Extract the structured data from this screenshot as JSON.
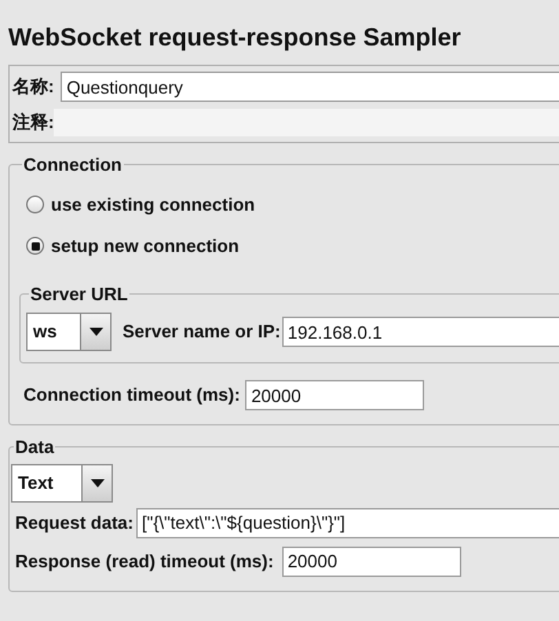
{
  "title": "WebSocket request-response Sampler",
  "name_field": {
    "label": "名称:",
    "value": "Questionquery"
  },
  "comment_field": {
    "label": "注释:"
  },
  "connection": {
    "legend": "Connection",
    "options": [
      {
        "label": "use existing connection",
        "selected": false
      },
      {
        "label": "setup new connection",
        "selected": true
      }
    ],
    "server_url": {
      "legend": "Server URL",
      "protocol": "ws",
      "host_label": "Server name or IP:",
      "host_value": "192.168.0.1"
    },
    "timeout": {
      "label": "Connection timeout (ms):",
      "value": "20000"
    }
  },
  "data": {
    "legend": "Data",
    "type": "Text",
    "request": {
      "label": "Request data:",
      "value": "[\"{\\\"text\\\":\\\"${question}\\\"}\"]"
    },
    "response_timeout": {
      "label": "Response (read) timeout (ms):",
      "value": "20000"
    }
  }
}
